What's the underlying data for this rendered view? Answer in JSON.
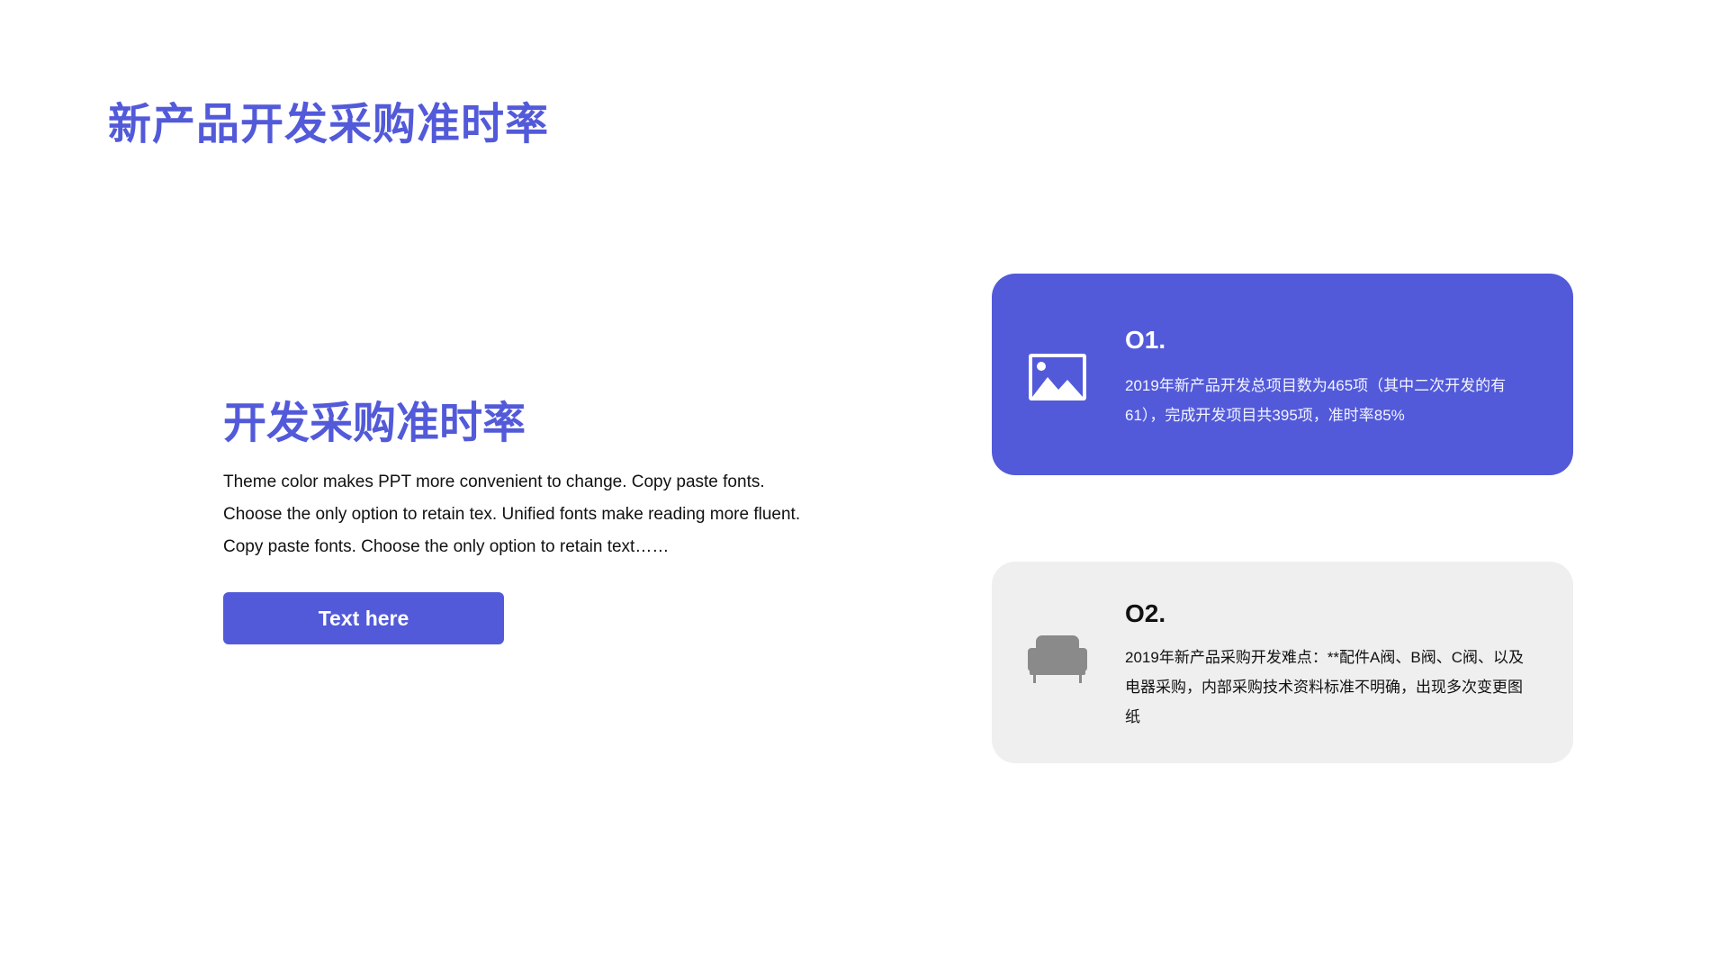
{
  "slide": {
    "title": "新产品开发采购准时率"
  },
  "left_section": {
    "heading": "开发采购准时率",
    "body": "Theme color makes PPT more convenient to change. Copy paste fonts. Choose the only option to retain tex. Unified fonts make reading more fluent. Copy paste fonts. Choose the only option to retain text……",
    "button_label": "Text here"
  },
  "cards": [
    {
      "number": "O1.",
      "text": "2019年新产品开发总项目数为465项（其中二次开发的有61），完成开发项目共395项，准时率85%",
      "icon": "image-icon"
    },
    {
      "number": "O2.",
      "text": "2019年新产品采购开发难点：**配件A阀、B阀、C阀、以及电器采购，内部采购技术资料标准不明确，出现多次变更图纸",
      "icon": "sofa-icon"
    }
  ],
  "colors": {
    "accent": "#525ad9",
    "card_gray": "#efefef",
    "text_dark": "#111111"
  }
}
